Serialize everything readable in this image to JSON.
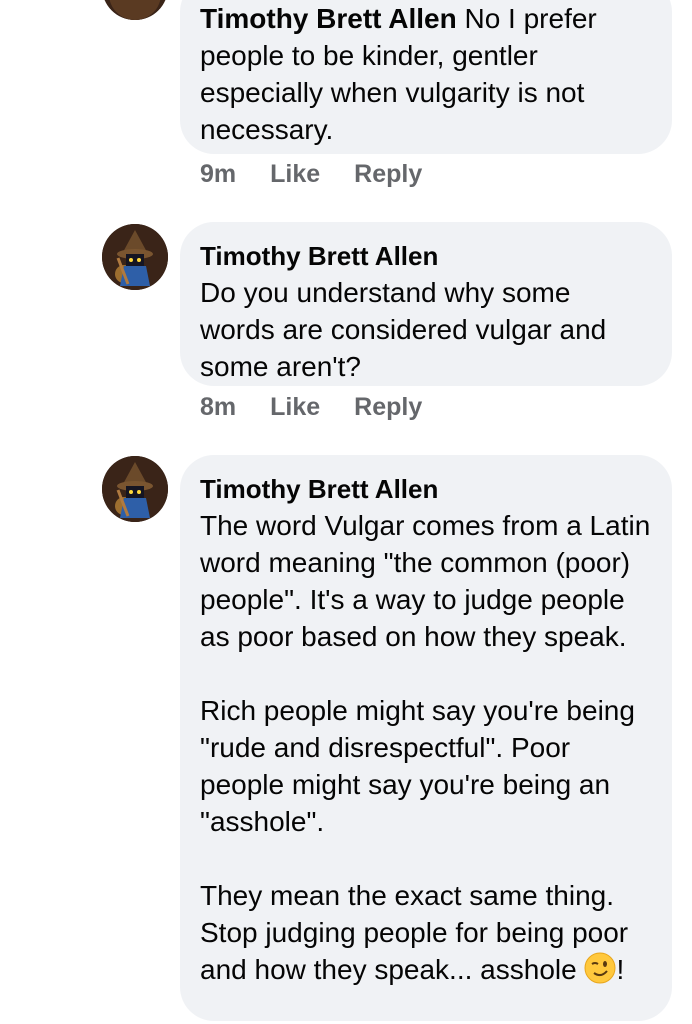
{
  "comments": [
    {
      "author": "Timothy Brett Allen",
      "text": " No I prefer people to be kinder, gentler especially when vulgarity is not necessary.",
      "time": "9m",
      "like_label": "Like",
      "reply_label": "Reply",
      "avatar_icon": "black-mage-avatar"
    },
    {
      "author": "Timothy Brett Allen",
      "text": "Do you understand why some words are considered vulgar and some aren't?",
      "time": "8m",
      "like_label": "Like",
      "reply_label": "Reply",
      "avatar_icon": "black-mage-avatar"
    },
    {
      "author": "Timothy Brett Allen",
      "paragraphs": [
        "The word Vulgar comes from a Latin word meaning \"the common (poor) people\". It's a way to judge people as poor based on how they speak.",
        "Rich people might say you're being \"rude and disrespectful\". Poor people might say you're being an \"asshole\".",
        "They mean the exact same thing. Stop judging people for being poor and how they speak... asshole"
      ],
      "trailing_text": "!",
      "emoji": "winking-face-emoji",
      "avatar_icon": "black-mage-avatar"
    }
  ],
  "colors": {
    "bubble": "#f0f2f5",
    "text": "#050505",
    "meta": "#65676b"
  }
}
